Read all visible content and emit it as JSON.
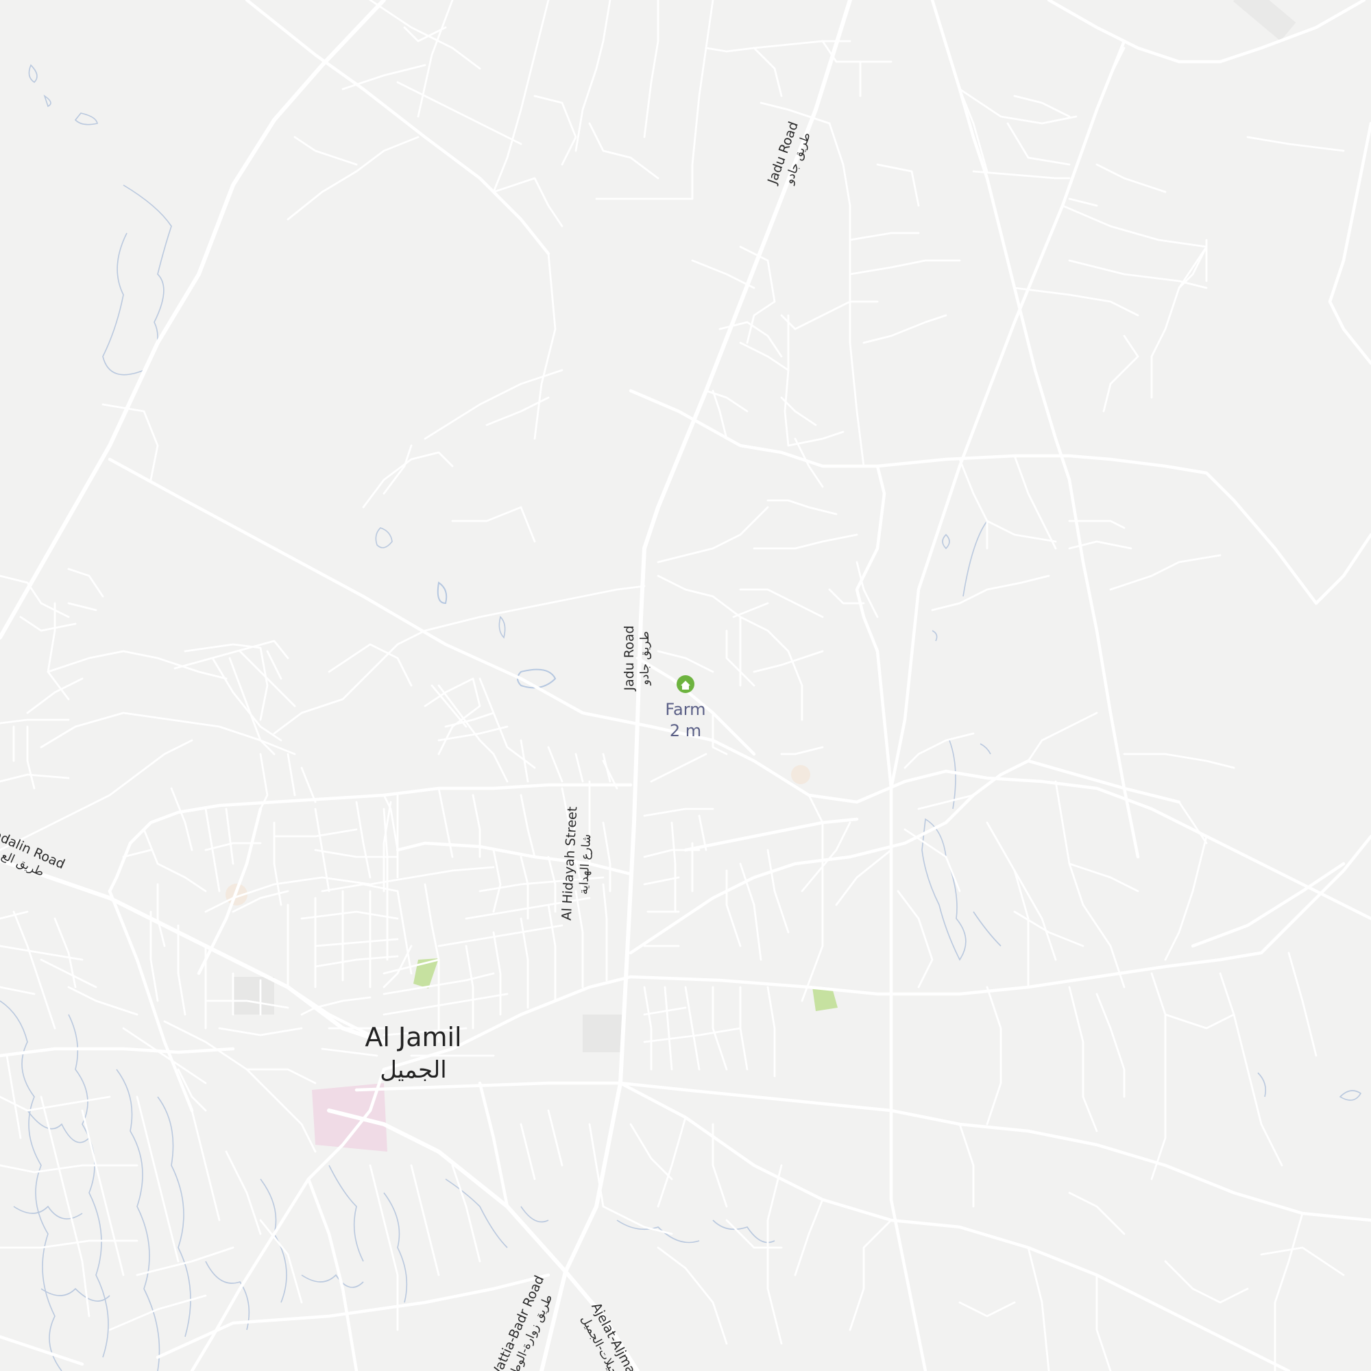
{
  "map": {
    "city": {
      "name": "Al Jamil",
      "name_ar": "الجميل"
    },
    "poi": {
      "name": "Farm",
      "distance": "2 m",
      "icon": "home-icon",
      "color": "#6db33f"
    },
    "roads": {
      "jadu_upper": {
        "name": "Jadu Road",
        "name_ar": "طريق جادو"
      },
      "jadu_lower": {
        "name": "Jadu Road",
        "name_ar": "طريق جادو"
      },
      "hidayah": {
        "name": "Al Hidayah Street",
        "name_ar": "شارع الهداية"
      },
      "west": {
        "name": "adalin Road",
        "name_ar": "طريق الع"
      },
      "wattia": {
        "name": "Wattia-Badr Road",
        "name_ar": "طريق زوارة-الوط"
      },
      "ajelat": {
        "name": "Ajelat-Aljmail",
        "name_ar": "عجيلات-الجميل"
      }
    },
    "colors": {
      "background": "#f2f2f1",
      "road": "#ffffff",
      "water": "#b9c8de",
      "park": "#c6e1a0",
      "hospital_area": "#f0dbe6"
    }
  }
}
